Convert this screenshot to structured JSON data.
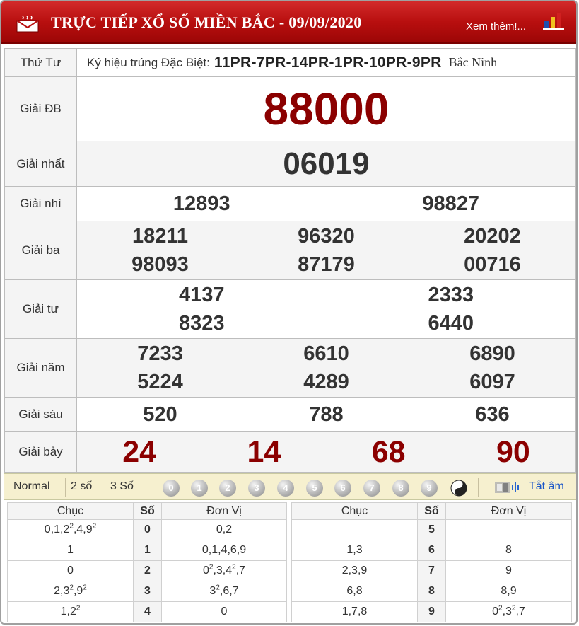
{
  "header": {
    "title": "TRỰC TIẾP XỔ SỐ MIỀN BẮC - 09/09/2020",
    "more_link": "Xem thêm!..."
  },
  "info_row": {
    "day": "Thứ Tư",
    "special_code_label": "Ký hiệu trúng Đặc Biệt:",
    "special_code": "11PR-7PR-14PR-1PR-10PR-9PR",
    "province": "Bắc Ninh"
  },
  "prizes": {
    "db": {
      "label": "Giải ĐB",
      "numbers": [
        "88000"
      ]
    },
    "nhat": {
      "label": "Giải nhất",
      "numbers": [
        "06019"
      ]
    },
    "nhi": {
      "label": "Giải nhì",
      "numbers": [
        "12893",
        "98827"
      ]
    },
    "ba": {
      "label": "Giải ba",
      "numbers": [
        "18211",
        "96320",
        "20202",
        "98093",
        "87179",
        "00716"
      ]
    },
    "tu": {
      "label": "Giải tư",
      "numbers": [
        "4137",
        "2333",
        "8323",
        "6440"
      ]
    },
    "nam": {
      "label": "Giải năm",
      "numbers": [
        "7233",
        "6610",
        "6890",
        "5224",
        "4289",
        "6097"
      ]
    },
    "sau": {
      "label": "Giải sáu",
      "numbers": [
        "520",
        "788",
        "636"
      ]
    },
    "bay": {
      "label": "Giải bảy",
      "numbers": [
        "24",
        "14",
        "68",
        "90"
      ]
    }
  },
  "filter_bar": {
    "options": [
      "Normal",
      "2 số",
      "3 Số"
    ],
    "digits": [
      "0",
      "1",
      "2",
      "3",
      "4",
      "5",
      "6",
      "7",
      "8",
      "9"
    ],
    "mute_label": "Tắt âm"
  },
  "loto": {
    "headers": {
      "chuc": "Chục",
      "so": "Số",
      "don_vi": "Đơn Vị"
    }
  },
  "colors": {
    "header_red": "#b80f0f",
    "special_red": "#8b0000",
    "filter_bg": "#f6f0cf",
    "link_blue": "#1a56c8"
  },
  "icons": [
    "mail-icon",
    "chart-icon",
    "yin-yang-icon",
    "speaker-icon"
  ]
}
